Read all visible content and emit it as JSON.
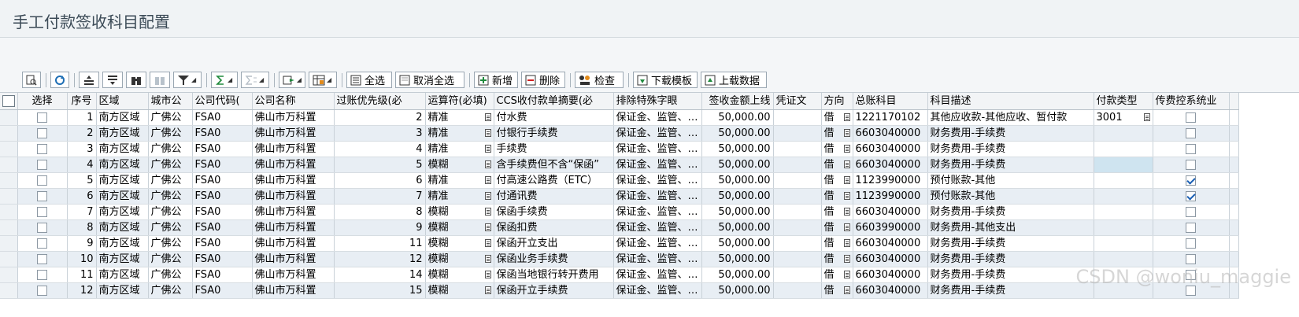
{
  "window": {
    "title": "手工付款签收科目配置"
  },
  "toolbar": {
    "select_all": "全选",
    "deselect_all": "取消全选",
    "add": "新增",
    "delete": "删除",
    "check": "检查",
    "download_template": "下载模板",
    "upload_data": "上载数据"
  },
  "columns": [
    "选择",
    "序号",
    "区域",
    "城市公",
    "公司代码(",
    "公司名称",
    "过账优先级(必",
    "运算符(必填)",
    "CCS收付款单摘要(必",
    "排除特殊字眼",
    "签收金额上线",
    "凭证文",
    "方向",
    "总账科目",
    "科目描述",
    "付款类型",
    "传费控系统业"
  ],
  "rows": [
    {
      "seq": "1",
      "region": "南方区域",
      "city": "广佛公",
      "code": "FSA0",
      "company": "佛山市万科置",
      "priority": "2",
      "op": "精准",
      "summary": "付水费",
      "exclude": "保证金、监管、",
      "amount": "50,000.00",
      "dir": "借",
      "gl": "1221170102",
      "desc": "其他应收款-其他应收、暂付款",
      "ptype": "3001",
      "sync": false
    },
    {
      "seq": "2",
      "region": "南方区域",
      "city": "广佛公",
      "code": "FSA0",
      "company": "佛山市万科置",
      "priority": "3",
      "op": "精准",
      "summary": "付银行手续费",
      "exclude": "保证金、监管、",
      "amount": "50,000.00",
      "dir": "借",
      "gl": "6603040000",
      "desc": "财务费用-手续费",
      "ptype": "",
      "sync": false
    },
    {
      "seq": "3",
      "region": "南方区域",
      "city": "广佛公",
      "code": "FSA0",
      "company": "佛山市万科置",
      "priority": "4",
      "op": "精准",
      "summary": "手续费",
      "exclude": "保证金、监管、",
      "amount": "50,000.00",
      "dir": "借",
      "gl": "6603040000",
      "desc": "财务费用-手续费",
      "ptype": "",
      "sync": false
    },
    {
      "seq": "4",
      "region": "南方区域",
      "city": "广佛公",
      "code": "FSA0",
      "company": "佛山市万科置",
      "priority": "5",
      "op": "模糊",
      "summary": "含手续费但不含“保函”",
      "exclude": "保证金、监管、",
      "amount": "50,000.00",
      "dir": "借",
      "gl": "6603040000",
      "desc": "财务费用-手续费",
      "ptype": "",
      "sync": false
    },
    {
      "seq": "5",
      "region": "南方区域",
      "city": "广佛公",
      "code": "FSA0",
      "company": "佛山市万科置",
      "priority": "6",
      "op": "精准",
      "summary": "付高速公路费（ETC）",
      "exclude": "保证金、监管、",
      "amount": "50,000.00",
      "dir": "借",
      "gl": "1123990000",
      "desc": "预付账款-其他",
      "ptype": "",
      "sync": true
    },
    {
      "seq": "6",
      "region": "南方区域",
      "city": "广佛公",
      "code": "FSA0",
      "company": "佛山市万科置",
      "priority": "7",
      "op": "精准",
      "summary": "付通讯费",
      "exclude": "保证金、监管、",
      "amount": "50,000.00",
      "dir": "借",
      "gl": "1123990000",
      "desc": "预付账款-其他",
      "ptype": "",
      "sync": true
    },
    {
      "seq": "7",
      "region": "南方区域",
      "city": "广佛公",
      "code": "FSA0",
      "company": "佛山市万科置",
      "priority": "8",
      "op": "模糊",
      "summary": "保函手续费",
      "exclude": "保证金、监管、",
      "amount": "50,000.00",
      "dir": "借",
      "gl": "6603040000",
      "desc": "财务费用-手续费",
      "ptype": "",
      "sync": false
    },
    {
      "seq": "8",
      "region": "南方区域",
      "city": "广佛公",
      "code": "FSA0",
      "company": "佛山市万科置",
      "priority": "9",
      "op": "模糊",
      "summary": "保函扣费",
      "exclude": "保证金、监管、",
      "amount": "50,000.00",
      "dir": "借",
      "gl": "6603990000",
      "desc": "财务费用-其他支出",
      "ptype": "",
      "sync": false
    },
    {
      "seq": "9",
      "region": "南方区域",
      "city": "广佛公",
      "code": "FSA0",
      "company": "佛山市万科置",
      "priority": "11",
      "op": "模糊",
      "summary": "保函开立支出",
      "exclude": "保证金、监管、",
      "amount": "50,000.00",
      "dir": "借",
      "gl": "6603040000",
      "desc": "财务费用-手续费",
      "ptype": "",
      "sync": false
    },
    {
      "seq": "10",
      "region": "南方区域",
      "city": "广佛公",
      "code": "FSA0",
      "company": "佛山市万科置",
      "priority": "12",
      "op": "模糊",
      "summary": "保函业务手续费",
      "exclude": "保证金、监管、",
      "amount": "50,000.00",
      "dir": "借",
      "gl": "6603040000",
      "desc": "财务费用-手续费",
      "ptype": "",
      "sync": false
    },
    {
      "seq": "11",
      "region": "南方区域",
      "city": "广佛公",
      "code": "FSA0",
      "company": "佛山市万科置",
      "priority": "14",
      "op": "模糊",
      "summary": "保函当地银行转开费用",
      "exclude": "保证金、监管、",
      "amount": "50,000.00",
      "dir": "借",
      "gl": "6603040000",
      "desc": "财务费用-手续费",
      "ptype": "",
      "sync": false
    },
    {
      "seq": "12",
      "region": "南方区域",
      "city": "广佛公",
      "code": "FSA0",
      "company": "佛山市万科置",
      "priority": "15",
      "op": "模糊",
      "summary": "保函开立手续费",
      "exclude": "保证金、监管、",
      "amount": "50,000.00",
      "dir": "借",
      "gl": "6603040000",
      "desc": "财务费用-手续费",
      "ptype": "",
      "sync": false
    }
  ],
  "watermark": "CSDN @woniu_maggie"
}
